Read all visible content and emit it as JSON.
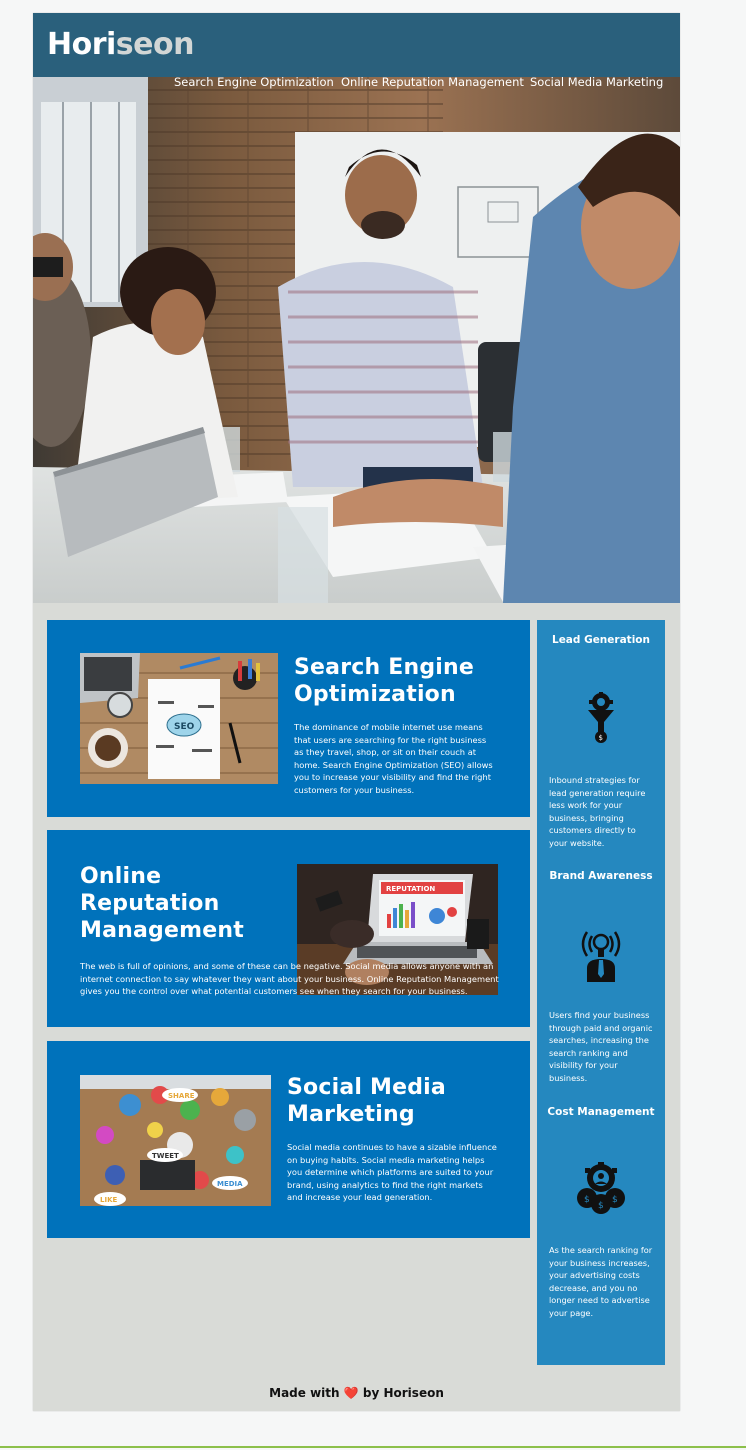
{
  "header": {
    "logo_main": "Hori",
    "logo_accent": "seon",
    "nav": [
      {
        "label": "Search Engine Optimization"
      },
      {
        "label": "Online Reputation Management"
      },
      {
        "label": "Social Media Marketing"
      }
    ]
  },
  "hero": {
    "image": "team-meeting-photo"
  },
  "content": [
    {
      "title": "Search Engine Optimization",
      "image": "seo-notebook-photo",
      "text": "The dominance of mobile internet use means that users are searching for the right business as they travel, shop, or sit on their couch at home. Search Engine Optimization (SEO) allows you to increase your visibility and find the right customers for your business.",
      "image_text": "SEO"
    },
    {
      "title": "Online Reputation Management",
      "image": "reputation-laptop-photo",
      "text": "The web is full of opinions, and some of these can be negative. Social media allows anyone with an internet connection to say whatever they want about your business. Online Reputation Management gives you the control over what potential customers see when they search for your business.",
      "image_text": "REPUTATION"
    },
    {
      "title": "Social Media Marketing",
      "image": "social-media-icons-photo",
      "text": "Social media continues to have a sizable influence on buying habits. Social media marketing helps you determine which platforms are suited to your brand, using analytics to find the right markets and increase your lead generation.",
      "image_words": [
        "SHARE",
        "TWEET",
        "LIKE",
        "MEDIA"
      ]
    }
  ],
  "benefits": [
    {
      "title": "Lead Generation",
      "icon": "funnel-icon",
      "text": "Inbound strategies for lead generation require less work for your business, bringing customers directly to your website."
    },
    {
      "title": "Brand Awareness",
      "icon": "lightbulb-broadcast-icon",
      "text": "Users find your business through paid and organic searches, increasing the search ranking and visibility for your business."
    },
    {
      "title": "Cost Management",
      "icon": "coins-gear-icon",
      "text": "As the search ranking for your business increases, your advertising costs decrease, and you no longer need to advertise your page."
    }
  ],
  "footer": {
    "before": "Made with",
    "heart": "❤️",
    "after": "by Horiseon"
  },
  "colors": {
    "header_bg": "#2a607c",
    "card_bg": "#0072bb",
    "aside_bg": "#2588bf",
    "page_bg": "#d9dbd7"
  }
}
